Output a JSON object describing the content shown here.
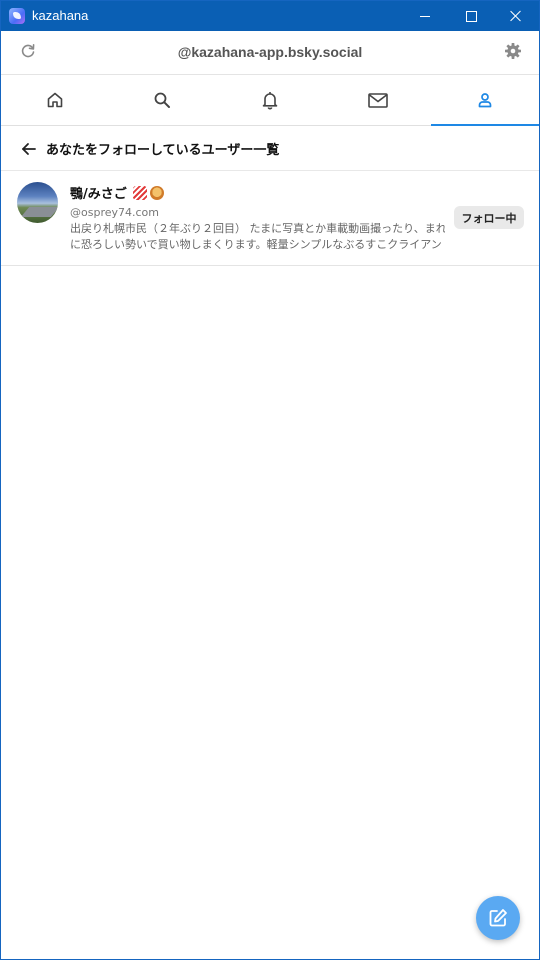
{
  "window": {
    "title": "kazahana"
  },
  "header": {
    "account": "@kazahana-app.bsky.social"
  },
  "tabs": [
    {
      "icon": "home-icon"
    },
    {
      "icon": "search-icon"
    },
    {
      "icon": "bell-icon"
    },
    {
      "icon": "mail-icon"
    },
    {
      "icon": "person-icon",
      "active": true
    }
  ],
  "page": {
    "title": "あなたをフォローしているユーザー一覧"
  },
  "users": [
    {
      "display_name": "鶚/みさご",
      "handle": "@osprey74.com",
      "bio_line1": "出戻り札幌市民（２年ぶり２回目） たまに写真とか車載動画撮ったり、まれ",
      "bio_line2": "に恐ろしい勢いで買い物しまくります。軽量シンプルなぶるすこクライアントアプリ...",
      "follow_label": "フォロー中"
    }
  ],
  "colors": {
    "accent": "#1e88e5",
    "titlebar": "#0a5fb4",
    "fab": "#5aa9f2"
  }
}
